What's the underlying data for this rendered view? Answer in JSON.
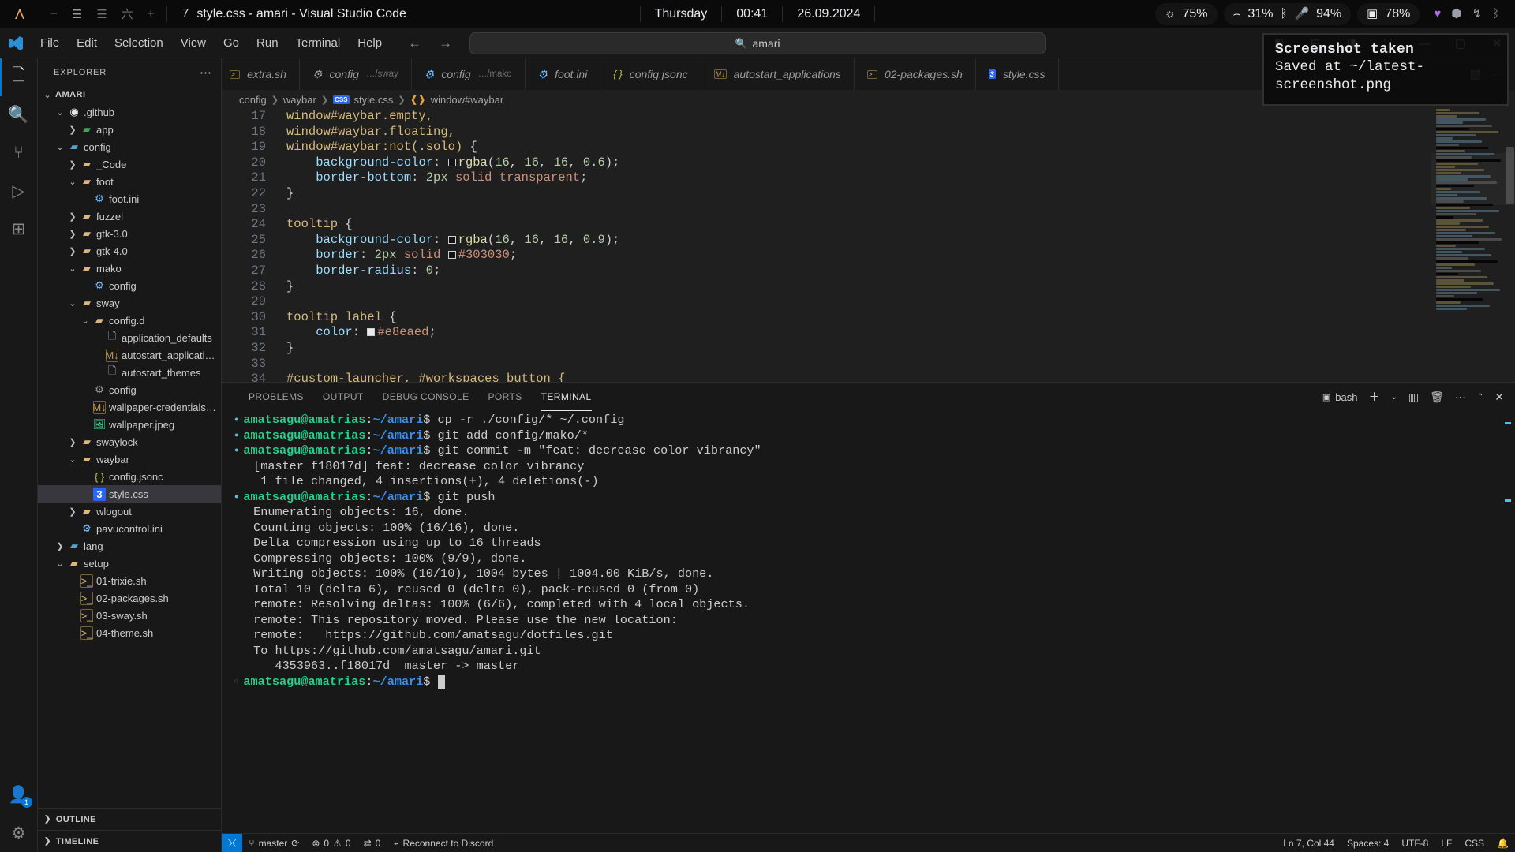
{
  "waybar": {
    "launcher_icon": "arch-logo-icon",
    "workspaces": [
      "−",
      "☰",
      "☰",
      "六",
      "+"
    ],
    "window_icon": "7",
    "window_title": "style.css - amari - Visual Studio Code",
    "day": "Thursday",
    "time": "00:41",
    "date": "26.09.2024",
    "brightness": {
      "icon": "brightness-icon",
      "value": "75%"
    },
    "headphones": {
      "icon": "headphones-icon",
      "value": "31%"
    },
    "bluetooth_icon": "bluetooth-icon",
    "microphone": {
      "icon": "microphone-icon",
      "value": "94%"
    },
    "battery": {
      "icon": "battery-icon",
      "value": "78%"
    },
    "tray": [
      "heart-icon",
      "shield-icon",
      "network-icon",
      "bluetooth-icon"
    ]
  },
  "notification": {
    "title": "Screenshot taken",
    "body": "Saved at ~/latest-screenshot.png"
  },
  "titlebar": {
    "menu": [
      "File",
      "Edit",
      "Selection",
      "View",
      "Go",
      "Run",
      "Terminal",
      "Help"
    ],
    "nav_back": "←",
    "nav_forward": "→",
    "search_icon": "search-icon",
    "search_value": "amari",
    "window_buttons": [
      "minimize",
      "maximize",
      "close"
    ]
  },
  "activitybar": {
    "items": [
      {
        "name": "explorer",
        "icon": "files-icon",
        "active": true
      },
      {
        "name": "search",
        "icon": "search-icon",
        "active": false
      },
      {
        "name": "source-control",
        "icon": "source-control-icon",
        "active": false
      },
      {
        "name": "run-and-debug",
        "icon": "debug-icon",
        "active": false
      },
      {
        "name": "extensions",
        "icon": "extensions-icon",
        "active": false
      }
    ],
    "accounts": {
      "icon": "account-icon",
      "badge": "1"
    },
    "settings": {
      "icon": "gear-icon"
    }
  },
  "sidebar": {
    "header": "EXPLORER",
    "more_icon": "ellipsis-icon",
    "tree": [
      {
        "label": "AMARI",
        "depth": 0,
        "twisty": "open",
        "icon": "none",
        "kind": "root"
      },
      {
        "label": ".github",
        "depth": 1,
        "twisty": "open",
        "icon": "github-icon",
        "kind": "folder"
      },
      {
        "label": "app",
        "depth": 2,
        "twisty": "closed",
        "icon": "app-folder-icon",
        "kind": "folder"
      },
      {
        "label": "config",
        "depth": 1,
        "twisty": "open",
        "icon": "config-folder-icon",
        "kind": "folder"
      },
      {
        "label": "_Code",
        "depth": 2,
        "twisty": "closed",
        "icon": "folder-icon",
        "kind": "folder"
      },
      {
        "label": "foot",
        "depth": 2,
        "twisty": "open",
        "icon": "folder-open-icon",
        "kind": "folder"
      },
      {
        "label": "foot.ini",
        "depth": 3,
        "twisty": "none",
        "icon": "gear-file-icon",
        "kind": "file"
      },
      {
        "label": "fuzzel",
        "depth": 2,
        "twisty": "closed",
        "icon": "folder-icon",
        "kind": "folder"
      },
      {
        "label": "gtk-3.0",
        "depth": 2,
        "twisty": "closed",
        "icon": "folder-icon",
        "kind": "folder"
      },
      {
        "label": "gtk-4.0",
        "depth": 2,
        "twisty": "closed",
        "icon": "folder-icon",
        "kind": "folder"
      },
      {
        "label": "mako",
        "depth": 2,
        "twisty": "open",
        "icon": "folder-open-icon",
        "kind": "folder"
      },
      {
        "label": "config",
        "depth": 3,
        "twisty": "none",
        "icon": "gear-file-icon",
        "kind": "file"
      },
      {
        "label": "sway",
        "depth": 2,
        "twisty": "open",
        "icon": "folder-open-icon",
        "kind": "folder"
      },
      {
        "label": "config.d",
        "depth": 3,
        "twisty": "open",
        "icon": "folder-open-icon",
        "kind": "folder"
      },
      {
        "label": "application_defaults",
        "depth": 4,
        "twisty": "none",
        "icon": "plain-file-icon",
        "kind": "file"
      },
      {
        "label": "autostart_applications",
        "depth": 4,
        "twisty": "none",
        "icon": "markdown-icon",
        "kind": "file"
      },
      {
        "label": "autostart_themes",
        "depth": 4,
        "twisty": "none",
        "icon": "plain-file-icon",
        "kind": "file"
      },
      {
        "label": "config",
        "depth": 3,
        "twisty": "none",
        "icon": "gears-file-icon",
        "kind": "file"
      },
      {
        "label": "wallpaper-credentials.md",
        "depth": 3,
        "twisty": "none",
        "icon": "markdown-icon",
        "kind": "file"
      },
      {
        "label": "wallpaper.jpeg",
        "depth": 3,
        "twisty": "none",
        "icon": "image-icon",
        "kind": "file"
      },
      {
        "label": "swaylock",
        "depth": 2,
        "twisty": "closed",
        "icon": "folder-icon",
        "kind": "folder"
      },
      {
        "label": "waybar",
        "depth": 2,
        "twisty": "open",
        "icon": "folder-open-icon",
        "kind": "folder"
      },
      {
        "label": "config.jsonc",
        "depth": 3,
        "twisty": "none",
        "icon": "jsonc-icon",
        "kind": "file"
      },
      {
        "label": "style.css",
        "depth": 3,
        "twisty": "none",
        "icon": "css-icon",
        "kind": "file",
        "selected": true
      },
      {
        "label": "wlogout",
        "depth": 2,
        "twisty": "closed",
        "icon": "folder-icon",
        "kind": "folder"
      },
      {
        "label": "pavucontrol.ini",
        "depth": 2,
        "twisty": "none",
        "icon": "gear-file-icon",
        "kind": "file"
      },
      {
        "label": "lang",
        "depth": 1,
        "twisty": "closed",
        "icon": "lang-folder-icon",
        "kind": "folder"
      },
      {
        "label": "setup",
        "depth": 1,
        "twisty": "open",
        "icon": "setup-folder-icon",
        "kind": "folder"
      },
      {
        "label": "01-trixie.sh",
        "depth": 2,
        "twisty": "none",
        "icon": "shell-icon",
        "kind": "file"
      },
      {
        "label": "02-packages.sh",
        "depth": 2,
        "twisty": "none",
        "icon": "shell-icon",
        "kind": "file"
      },
      {
        "label": "03-sway.sh",
        "depth": 2,
        "twisty": "none",
        "icon": "shell-icon",
        "kind": "file"
      },
      {
        "label": "04-theme.sh",
        "depth": 2,
        "twisty": "none",
        "icon": "shell-icon",
        "kind": "file"
      }
    ],
    "sections": [
      {
        "label": "OUTLINE",
        "twisty": "closed"
      },
      {
        "label": "TIMELINE",
        "twisty": "closed"
      }
    ]
  },
  "tabs": [
    {
      "label": "extra.sh",
      "path": "",
      "icon": "shell-icon"
    },
    {
      "label": "config",
      "path": "…/sway",
      "icon": "gears-file-icon"
    },
    {
      "label": "config",
      "path": "…/mako",
      "icon": "gear-file-icon"
    },
    {
      "label": "foot.ini",
      "path": "",
      "icon": "gear-file-icon"
    },
    {
      "label": "config.jsonc",
      "path": "",
      "icon": "jsonc-icon"
    },
    {
      "label": "autostart_applications",
      "path": "",
      "icon": "markdown-icon"
    },
    {
      "label": "02-packages.sh",
      "path": "",
      "icon": "shell-icon"
    },
    {
      "label": "style.css",
      "path": "",
      "icon": "css-icon",
      "active": true
    }
  ],
  "tab_actions": {
    "split_icon": "split-editor-icon",
    "more_icon": "ellipsis-icon"
  },
  "breadcrumbs": [
    "config",
    "waybar",
    "style.css",
    "window#waybar"
  ],
  "editor": {
    "first_line": 17,
    "lines": [
      {
        "n": 17,
        "tokens": [
          {
            "t": "window#waybar.empty,",
            "c": "tok-sel"
          }
        ]
      },
      {
        "n": 18,
        "tokens": [
          {
            "t": "window#waybar.floating,",
            "c": "tok-sel"
          }
        ]
      },
      {
        "n": 19,
        "tokens": [
          {
            "t": "window#waybar:not(.solo)",
            "c": "tok-sel"
          },
          {
            "t": " {",
            "c": "tok-punc"
          }
        ]
      },
      {
        "n": 20,
        "tokens": [
          {
            "t": "    ",
            "c": "tok-punc"
          },
          {
            "t": "background-color",
            "c": "tok-prop"
          },
          {
            "t": ": ",
            "c": "tok-punc"
          },
          {
            "t": "SWATCH",
            "c": "swatch-token"
          },
          {
            "t": "rgba",
            "c": "tok-fn"
          },
          {
            "t": "(",
            "c": "tok-punc"
          },
          {
            "t": "16",
            "c": "tok-num"
          },
          {
            "t": ", ",
            "c": "tok-punc"
          },
          {
            "t": "16",
            "c": "tok-num"
          },
          {
            "t": ", ",
            "c": "tok-punc"
          },
          {
            "t": "16",
            "c": "tok-num"
          },
          {
            "t": ", ",
            "c": "tok-punc"
          },
          {
            "t": "0.6",
            "c": "tok-num"
          },
          {
            "t": ");",
            "c": "tok-punc"
          }
        ]
      },
      {
        "n": 21,
        "tokens": [
          {
            "t": "    ",
            "c": "tok-punc"
          },
          {
            "t": "border-bottom",
            "c": "tok-prop"
          },
          {
            "t": ": ",
            "c": "tok-punc"
          },
          {
            "t": "2px",
            "c": "tok-num"
          },
          {
            "t": " ",
            "c": "tok-punc"
          },
          {
            "t": "solid transparent",
            "c": "tok-kw"
          },
          {
            "t": ";",
            "c": "tok-punc"
          }
        ]
      },
      {
        "n": 22,
        "tokens": [
          {
            "t": "}",
            "c": "tok-punc"
          }
        ]
      },
      {
        "n": 23,
        "tokens": []
      },
      {
        "n": 24,
        "tokens": [
          {
            "t": "tooltip",
            "c": "tok-sel"
          },
          {
            "t": " {",
            "c": "tok-punc"
          }
        ]
      },
      {
        "n": 25,
        "tokens": [
          {
            "t": "    ",
            "c": "tok-punc"
          },
          {
            "t": "background-color",
            "c": "tok-prop"
          },
          {
            "t": ": ",
            "c": "tok-punc"
          },
          {
            "t": "SWATCH",
            "c": "swatch-token"
          },
          {
            "t": "rgba",
            "c": "tok-fn"
          },
          {
            "t": "(",
            "c": "tok-punc"
          },
          {
            "t": "16",
            "c": "tok-num"
          },
          {
            "t": ", ",
            "c": "tok-punc"
          },
          {
            "t": "16",
            "c": "tok-num"
          },
          {
            "t": ", ",
            "c": "tok-punc"
          },
          {
            "t": "16",
            "c": "tok-num"
          },
          {
            "t": ", ",
            "c": "tok-punc"
          },
          {
            "t": "0.9",
            "c": "tok-num"
          },
          {
            "t": ");",
            "c": "tok-punc"
          }
        ]
      },
      {
        "n": 26,
        "tokens": [
          {
            "t": "    ",
            "c": "tok-punc"
          },
          {
            "t": "border",
            "c": "tok-prop"
          },
          {
            "t": ": ",
            "c": "tok-punc"
          },
          {
            "t": "2px",
            "c": "tok-num"
          },
          {
            "t": " ",
            "c": "tok-punc"
          },
          {
            "t": "solid",
            "c": "tok-kw"
          },
          {
            "t": " ",
            "c": "tok-punc"
          },
          {
            "t": "SWATCH",
            "c": "swatch-token"
          },
          {
            "t": "#303030",
            "c": "tok-val"
          },
          {
            "t": ";",
            "c": "tok-punc"
          }
        ]
      },
      {
        "n": 27,
        "tokens": [
          {
            "t": "    ",
            "c": "tok-punc"
          },
          {
            "t": "border-radius",
            "c": "tok-prop"
          },
          {
            "t": ": ",
            "c": "tok-punc"
          },
          {
            "t": "0",
            "c": "tok-num"
          },
          {
            "t": ";",
            "c": "tok-punc"
          }
        ]
      },
      {
        "n": 28,
        "tokens": [
          {
            "t": "}",
            "c": "tok-punc"
          }
        ]
      },
      {
        "n": 29,
        "tokens": []
      },
      {
        "n": 30,
        "tokens": [
          {
            "t": "tooltip",
            "c": "tok-sel"
          },
          {
            "t": " ",
            "c": "tok-punc"
          },
          {
            "t": "label",
            "c": "tok-sel"
          },
          {
            "t": " {",
            "c": "tok-punc"
          }
        ]
      },
      {
        "n": 31,
        "tokens": [
          {
            "t": "    ",
            "c": "tok-punc"
          },
          {
            "t": "color",
            "c": "tok-prop"
          },
          {
            "t": ": ",
            "c": "tok-punc"
          },
          {
            "t": "SWATCH_LIGHT",
            "c": "swatch-token"
          },
          {
            "t": "#e8eaed",
            "c": "tok-val"
          },
          {
            "t": ";",
            "c": "tok-punc"
          }
        ]
      },
      {
        "n": 32,
        "tokens": [
          {
            "t": "}",
            "c": "tok-punc"
          }
        ]
      },
      {
        "n": 33,
        "tokens": []
      },
      {
        "n": 34,
        "tokens": [
          {
            "t": "#custom-launcher, #workspaces button {",
            "c": "tok-sel"
          }
        ]
      }
    ]
  },
  "panel": {
    "tabs": [
      "PROBLEMS",
      "OUTPUT",
      "DEBUG CONSOLE",
      "PORTS",
      "TERMINAL"
    ],
    "active_tab": "TERMINAL",
    "shell": "bash",
    "actions": [
      "add-terminal-icon",
      "chevron-down-icon",
      "split-terminal-icon",
      "trash-icon",
      "ellipsis-icon",
      "chevron-up-icon",
      "close-icon"
    ]
  },
  "terminal": {
    "prompt_user": "amatsagu",
    "prompt_at": "@",
    "prompt_host": "amatrias",
    "prompt_sep": ":",
    "prompt_path": "~/amari",
    "prompt_dollar": "$ ",
    "lines": [
      {
        "type": "prompt",
        "cmd": "cp -r ./config/* ~/.config",
        "marker": true
      },
      {
        "type": "prompt",
        "cmd": "git add config/mako/*",
        "marker": true
      },
      {
        "type": "prompt",
        "cmd": "git commit -m \"feat: decrease color vibrancy\"",
        "marker": true
      },
      {
        "type": "out",
        "text": " [master f18017d] feat: decrease color vibrancy"
      },
      {
        "type": "out",
        "text": "  1 file changed, 4 insertions(+), 4 deletions(-)"
      },
      {
        "type": "prompt",
        "cmd": "git push",
        "marker": true
      },
      {
        "type": "out",
        "text": " Enumerating objects: 16, done."
      },
      {
        "type": "out",
        "text": " Counting objects: 100% (16/16), done."
      },
      {
        "type": "out",
        "text": " Delta compression using up to 16 threads"
      },
      {
        "type": "out",
        "text": " Compressing objects: 100% (9/9), done."
      },
      {
        "type": "out",
        "text": " Writing objects: 100% (10/10), 1004 bytes | 1004.00 KiB/s, done."
      },
      {
        "type": "out",
        "text": " Total 10 (delta 6), reused 0 (delta 0), pack-reused 0 (from 0)"
      },
      {
        "type": "out",
        "text": " remote: Resolving deltas: 100% (6/6), completed with 4 local objects."
      },
      {
        "type": "out",
        "text": " remote: This repository moved. Please use the new location:"
      },
      {
        "type": "out",
        "text": " remote:   https://github.com/amatsagu/dotfiles.git"
      },
      {
        "type": "out",
        "text": " To https://github.com/amatsagu/amari.git"
      },
      {
        "type": "out",
        "text": "    4353963..f18017d  master -> master"
      },
      {
        "type": "prompt",
        "cmd": "",
        "marker": false,
        "cursor": true
      }
    ]
  },
  "statusbar": {
    "remote_icon": "remote-indicator-icon",
    "branch_icon": "source-control-icon",
    "branch": "master",
    "sync_icon": "sync-icon",
    "errors_icon": "error-icon",
    "errors": "0",
    "warnings_icon": "warning-icon",
    "warnings": "0",
    "ports_icon": "ports-icon",
    "ports": "0",
    "discord_icon": "plug-icon",
    "discord": "Reconnect to Discord",
    "cursor_position": "Ln 7, Col 44",
    "indentation": "Spaces: 4",
    "encoding": "UTF-8",
    "eol": "LF",
    "language": "CSS",
    "bell_icon": "bell-icon"
  },
  "colors": {
    "accent": "#0078d4",
    "terminal_green": "#23d18b",
    "terminal_blue": "#3b8eea",
    "selector": "#d7ba7d",
    "property": "#9cdcfe"
  }
}
